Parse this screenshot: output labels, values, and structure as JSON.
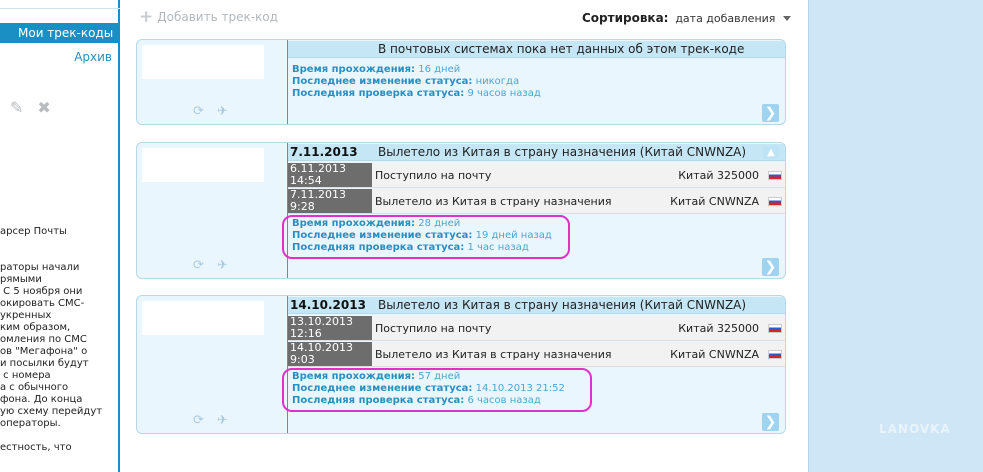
{
  "sidebar": {
    "active_tab": "Мои трек-коды",
    "archive": "Архив",
    "news_text": "арсер Почты\n\n\nраторы начали\nрямыми\n С 5 ноября они\nокировать СМС-\nукренных\nким образом,\nомления по СМС\nов \"Мегафона\" о\nи посылки будут\n с номера\nа с обычного\nфона. До конца\nую схему перейдут\nоператоры.\n\nестность, что"
  },
  "header": {
    "add_label": "Добавить трек-код",
    "sort_label": "Сортировка:",
    "sort_value": "дата добавления"
  },
  "cards": [
    {
      "date": "",
      "status": "В почтовых системах пока нет данных об этом трек-коде",
      "events": [],
      "stats": {
        "transit_label": "Время прохождения:",
        "transit_value": "16 дней",
        "last_change_label": "Последнее изменение статуса:",
        "last_change_value": "никогда",
        "last_check_label": "Последняя проверка статуса:",
        "last_check_value": "9 часов назад"
      }
    },
    {
      "date": "7.11.2013",
      "status": "Вылетело из Китая в страну назначения (Китай CNWNZA)",
      "events": [
        {
          "when": "6.11.2013\n14:54",
          "what": "Поступило на почту",
          "where": "Китай 325000"
        },
        {
          "when": "7.11.2013\n9:28",
          "what": "Вылетело из Китая в страну назначения",
          "where": "Китай CNWNZA"
        }
      ],
      "stats": {
        "transit_label": "Время прохождения:",
        "transit_value": "28 дней",
        "last_change_label": "Последнее изменение статуса:",
        "last_change_value": "19 дней назад",
        "last_check_label": "Последняя проверка статуса:",
        "last_check_value": "1 час назад"
      }
    },
    {
      "date": "14.10.2013",
      "status": "Вылетело из Китая в страну назначения (Китай CNWNZA)",
      "events": [
        {
          "when": "13.10.2013\n12:16",
          "what": "Поступило на почту",
          "where": "Китай 325000"
        },
        {
          "when": "14.10.2013\n9:03",
          "what": "Вылетело из Китая в страну назначения",
          "where": "Китай CNWNZA"
        }
      ],
      "stats": {
        "transit_label": "Время прохождения:",
        "transit_value": "57 дней",
        "last_change_label": "Последнее изменение статуса:",
        "last_change_value": "14.10.2013 21:52",
        "last_check_label": "Последняя проверка статуса:",
        "last_check_value": "6 часов назад"
      }
    }
  ],
  "watermark": "LANOVKA",
  "colors": {
    "accent": "#1a8fc4",
    "highlight": "#e030c8",
    "stat_text": "#2a8fc0"
  }
}
